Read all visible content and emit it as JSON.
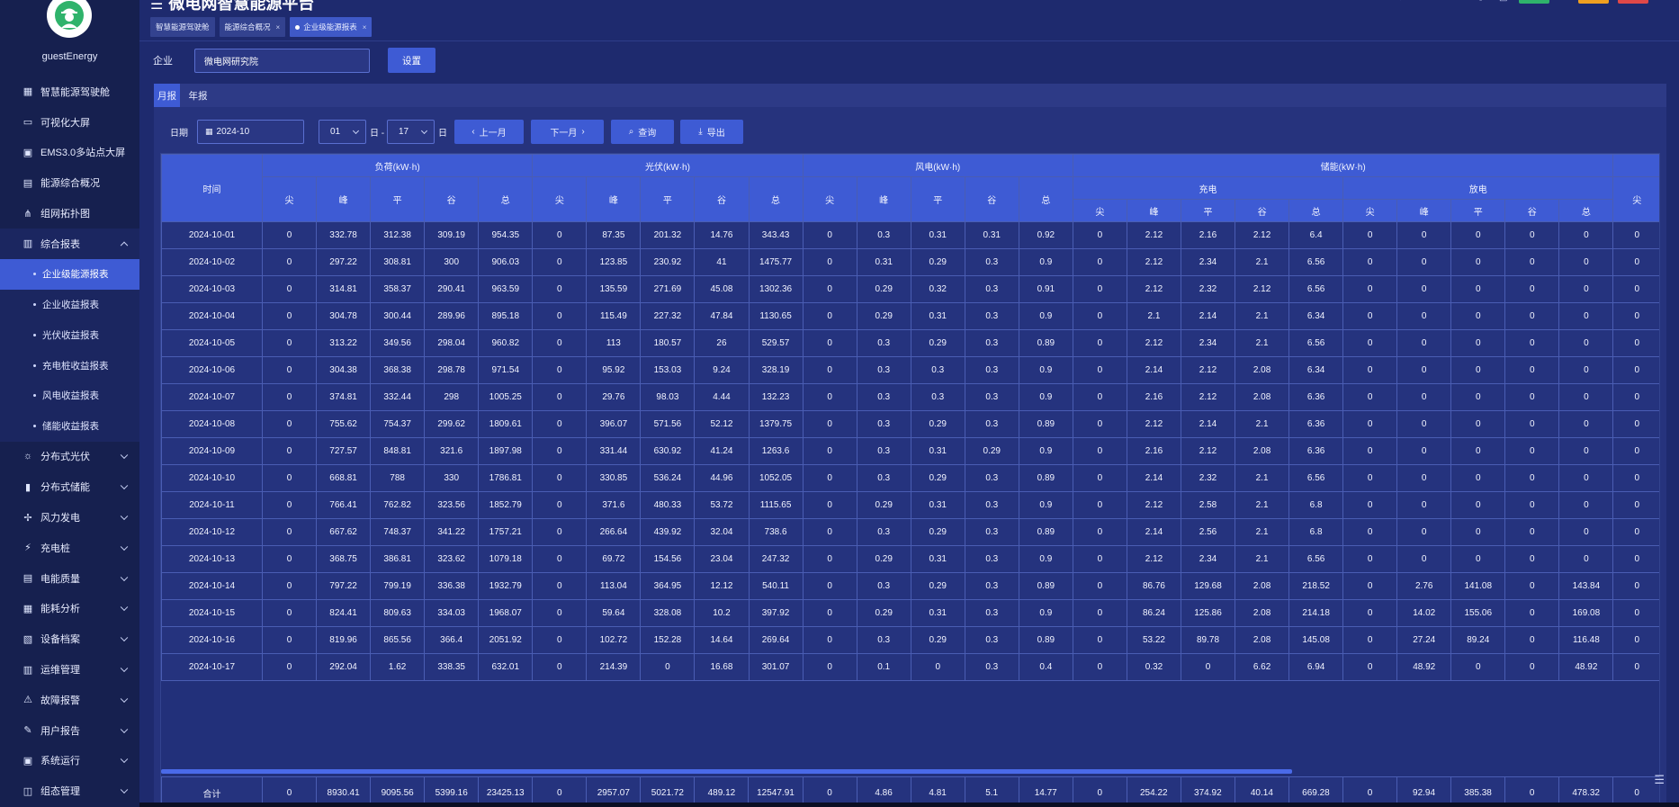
{
  "app": {
    "title": "微电网智慧能源平台",
    "username": "guestEnergy"
  },
  "tabs": [
    {
      "label": "智慧能源驾驶舱"
    },
    {
      "label": "能源综合概况",
      "close": "×"
    },
    {
      "label": "企业级能源报表",
      "close": "×"
    }
  ],
  "sidebar": {
    "items": [
      {
        "label": "智慧能源驾驶舱",
        "icon": "cockpit-icon"
      },
      {
        "label": "可视化大屏",
        "icon": "screen-icon"
      },
      {
        "label": "EMS3.0多站点大屏",
        "icon": "monitor-icon"
      },
      {
        "label": "能源综合概况",
        "icon": "overview-icon"
      },
      {
        "label": "组网拓扑图",
        "icon": "topology-icon"
      },
      {
        "label": "综合报表",
        "icon": "report-icon"
      },
      {
        "label": "分布式光伏",
        "icon": "solar-icon"
      },
      {
        "label": "分布式储能",
        "icon": "storage-icon"
      },
      {
        "label": "风力发电",
        "icon": "wind-icon"
      },
      {
        "label": "充电桩",
        "icon": "charger-icon"
      },
      {
        "label": "电能质量",
        "icon": "quality-icon"
      },
      {
        "label": "能耗分析",
        "icon": "analysis-icon"
      },
      {
        "label": "设备档案",
        "icon": "archive-icon"
      },
      {
        "label": "运维管理",
        "icon": "maintenance-icon"
      },
      {
        "label": "故障报警",
        "icon": "alarm-icon"
      },
      {
        "label": "用户报告",
        "icon": "user-report-icon"
      },
      {
        "label": "系统运行",
        "icon": "system-icon"
      },
      {
        "label": "组态管理",
        "icon": "config-icon"
      }
    ],
    "subitems": [
      "企业级能源报表",
      "企业收益报表",
      "光伏收益报表",
      "充电桩收益报表",
      "风电收益报表",
      "储能收益报表"
    ]
  },
  "filter": {
    "label": "企业",
    "value": "微电网研究院",
    "button": "设置"
  },
  "panel_tabs": [
    "月报",
    "年报"
  ],
  "query": {
    "date_label": "日期",
    "date_value": "2024-10",
    "start_day": "01",
    "sep": "日 -",
    "end_day": "17",
    "day_suffix": "日",
    "prev": "上一月",
    "next": "下一月",
    "search": "查询",
    "export": "导出"
  },
  "table": {
    "time_header": "时间",
    "groups": [
      "负荷(kW·h)",
      "光伏(kW·h)",
      "风电(kW·h)",
      "储能(kW·h)"
    ],
    "storage_sub": [
      "充电",
      "放电"
    ],
    "cols": [
      "尖",
      "峰",
      "平",
      "谷",
      "总"
    ],
    "rows": [
      [
        "2024-10-01",
        "0",
        "332.78",
        "312.38",
        "309.19",
        "954.35",
        "0",
        "87.35",
        "201.32",
        "14.76",
        "343.43",
        "0",
        "0.3",
        "0.31",
        "0.31",
        "0.92",
        "0",
        "2.12",
        "2.16",
        "2.12",
        "6.4",
        "0",
        "0",
        "0",
        "0",
        "0",
        "0"
      ],
      [
        "2024-10-02",
        "0",
        "297.22",
        "308.81",
        "300",
        "906.03",
        "0",
        "123.85",
        "230.92",
        "41",
        "1475.77",
        "0",
        "0.31",
        "0.29",
        "0.3",
        "0.9",
        "0",
        "2.12",
        "2.34",
        "2.1",
        "6.56",
        "0",
        "0",
        "0",
        "0",
        "0",
        "0"
      ],
      [
        "2024-10-03",
        "0",
        "314.81",
        "358.37",
        "290.41",
        "963.59",
        "0",
        "135.59",
        "271.69",
        "45.08",
        "1302.36",
        "0",
        "0.29",
        "0.32",
        "0.3",
        "0.91",
        "0",
        "2.12",
        "2.32",
        "2.12",
        "6.56",
        "0",
        "0",
        "0",
        "0",
        "0",
        "0"
      ],
      [
        "2024-10-04",
        "0",
        "304.78",
        "300.44",
        "289.96",
        "895.18",
        "0",
        "115.49",
        "227.32",
        "47.84",
        "1130.65",
        "0",
        "0.29",
        "0.31",
        "0.3",
        "0.9",
        "0",
        "2.1",
        "2.14",
        "2.1",
        "6.34",
        "0",
        "0",
        "0",
        "0",
        "0",
        "0"
      ],
      [
        "2024-10-05",
        "0",
        "313.22",
        "349.56",
        "298.04",
        "960.82",
        "0",
        "113",
        "180.57",
        "26",
        "529.57",
        "0",
        "0.3",
        "0.29",
        "0.3",
        "0.89",
        "0",
        "2.12",
        "2.34",
        "2.1",
        "6.56",
        "0",
        "0",
        "0",
        "0",
        "0",
        "0"
      ],
      [
        "2024-10-06",
        "0",
        "304.38",
        "368.38",
        "298.78",
        "971.54",
        "0",
        "95.92",
        "153.03",
        "9.24",
        "328.19",
        "0",
        "0.3",
        "0.3",
        "0.3",
        "0.9",
        "0",
        "2.14",
        "2.12",
        "2.08",
        "6.34",
        "0",
        "0",
        "0",
        "0",
        "0",
        "0"
      ],
      [
        "2024-10-07",
        "0",
        "374.81",
        "332.44",
        "298",
        "1005.25",
        "0",
        "29.76",
        "98.03",
        "4.44",
        "132.23",
        "0",
        "0.3",
        "0.3",
        "0.3",
        "0.9",
        "0",
        "2.16",
        "2.12",
        "2.08",
        "6.36",
        "0",
        "0",
        "0",
        "0",
        "0",
        "0"
      ],
      [
        "2024-10-08",
        "0",
        "755.62",
        "754.37",
        "299.62",
        "1809.61",
        "0",
        "396.07",
        "571.56",
        "52.12",
        "1379.75",
        "0",
        "0.3",
        "0.29",
        "0.3",
        "0.89",
        "0",
        "2.12",
        "2.14",
        "2.1",
        "6.36",
        "0",
        "0",
        "0",
        "0",
        "0",
        "0"
      ],
      [
        "2024-10-09",
        "0",
        "727.57",
        "848.81",
        "321.6",
        "1897.98",
        "0",
        "331.44",
        "630.92",
        "41.24",
        "1263.6",
        "0",
        "0.3",
        "0.31",
        "0.29",
        "0.9",
        "0",
        "2.16",
        "2.12",
        "2.08",
        "6.36",
        "0",
        "0",
        "0",
        "0",
        "0",
        "0"
      ],
      [
        "2024-10-10",
        "0",
        "668.81",
        "788",
        "330",
        "1786.81",
        "0",
        "330.85",
        "536.24",
        "44.96",
        "1052.05",
        "0",
        "0.3",
        "0.29",
        "0.3",
        "0.89",
        "0",
        "2.14",
        "2.32",
        "2.1",
        "6.56",
        "0",
        "0",
        "0",
        "0",
        "0",
        "0"
      ],
      [
        "2024-10-11",
        "0",
        "766.41",
        "762.82",
        "323.56",
        "1852.79",
        "0",
        "371.6",
        "480.33",
        "53.72",
        "1115.65",
        "0",
        "0.29",
        "0.31",
        "0.3",
        "0.9",
        "0",
        "2.12",
        "2.58",
        "2.1",
        "6.8",
        "0",
        "0",
        "0",
        "0",
        "0",
        "0"
      ],
      [
        "2024-10-12",
        "0",
        "667.62",
        "748.37",
        "341.22",
        "1757.21",
        "0",
        "266.64",
        "439.92",
        "32.04",
        "738.6",
        "0",
        "0.3",
        "0.29",
        "0.3",
        "0.89",
        "0",
        "2.14",
        "2.56",
        "2.1",
        "6.8",
        "0",
        "0",
        "0",
        "0",
        "0",
        "0"
      ],
      [
        "2024-10-13",
        "0",
        "368.75",
        "386.81",
        "323.62",
        "1079.18",
        "0",
        "69.72",
        "154.56",
        "23.04",
        "247.32",
        "0",
        "0.29",
        "0.31",
        "0.3",
        "0.9",
        "0",
        "2.12",
        "2.34",
        "2.1",
        "6.56",
        "0",
        "0",
        "0",
        "0",
        "0",
        "0"
      ],
      [
        "2024-10-14",
        "0",
        "797.22",
        "799.19",
        "336.38",
        "1932.79",
        "0",
        "113.04",
        "364.95",
        "12.12",
        "540.11",
        "0",
        "0.3",
        "0.29",
        "0.3",
        "0.89",
        "0",
        "86.76",
        "129.68",
        "2.08",
        "218.52",
        "0",
        "2.76",
        "141.08",
        "0",
        "143.84",
        "0"
      ],
      [
        "2024-10-15",
        "0",
        "824.41",
        "809.63",
        "334.03",
        "1968.07",
        "0",
        "59.64",
        "328.08",
        "10.2",
        "397.92",
        "0",
        "0.29",
        "0.31",
        "0.3",
        "0.9",
        "0",
        "86.24",
        "125.86",
        "2.08",
        "214.18",
        "0",
        "14.02",
        "155.06",
        "0",
        "169.08",
        "0"
      ],
      [
        "2024-10-16",
        "0",
        "819.96",
        "865.56",
        "366.4",
        "2051.92",
        "0",
        "102.72",
        "152.28",
        "14.64",
        "269.64",
        "0",
        "0.3",
        "0.29",
        "0.3",
        "0.89",
        "0",
        "53.22",
        "89.78",
        "2.08",
        "145.08",
        "0",
        "27.24",
        "89.24",
        "0",
        "116.48",
        "0"
      ],
      [
        "2024-10-17",
        "0",
        "292.04",
        "1.62",
        "338.35",
        "632.01",
        "0",
        "214.39",
        "0",
        "16.68",
        "301.07",
        "0",
        "0.1",
        "0",
        "0.3",
        "0.4",
        "0",
        "0.32",
        "0",
        "6.62",
        "6.94",
        "0",
        "48.92",
        "0",
        "0",
        "48.92",
        "0"
      ]
    ],
    "total": [
      "合计",
      "0",
      "8930.41",
      "9095.56",
      "5399.16",
      "23425.13",
      "0",
      "2957.07",
      "5021.72",
      "489.12",
      "12547.91",
      "0",
      "4.86",
      "4.81",
      "5.1",
      "14.77",
      "0",
      "254.22",
      "374.92",
      "40.14",
      "669.28",
      "0",
      "92.94",
      "385.38",
      "0",
      "478.32",
      "0"
    ]
  },
  "colors": {
    "primary": "#3e5bd4",
    "bg": "#1e2a6e",
    "sidebar": "#16204f"
  }
}
